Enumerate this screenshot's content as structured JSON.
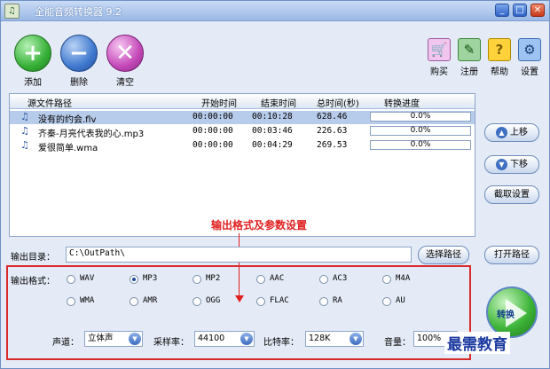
{
  "window": {
    "title": "全能音频转换器 9.2"
  },
  "toolbar": {
    "add": "添加",
    "delete": "删除",
    "clear": "清空"
  },
  "rightbar": {
    "buy": "购买",
    "register": "注册",
    "help": "帮助",
    "settings": "设置"
  },
  "filelist": {
    "headers": {
      "path": "源文件路径",
      "start": "开始时间",
      "end": "结束时间",
      "total": "总时间(秒)",
      "progress": "转换进度"
    },
    "rows": [
      {
        "name": "没有的约会.flv",
        "start": "00:00:00",
        "end": "00:10:28",
        "total": "628.46",
        "progress": "0.0%"
      },
      {
        "name": "齐秦-月亮代表我的心.mp3",
        "start": "00:00:00",
        "end": "00:03:46",
        "total": "226.63",
        "progress": "0.0%"
      },
      {
        "name": "爱很简单.wma",
        "start": "00:00:00",
        "end": "00:04:29",
        "total": "269.53",
        "progress": "0.0%"
      }
    ]
  },
  "sidebar": {
    "up": "上移",
    "down": "下移",
    "cut": "截取设置"
  },
  "annotation": "输出格式及参数设置",
  "output": {
    "label": "输出目录：",
    "path": "C:\\OutPath\\",
    "browse": "选择路径",
    "open": "打开路径"
  },
  "format": {
    "label": "输出格式：",
    "options": [
      "WAV",
      "MP3",
      "MP2",
      "AAC",
      "AC3",
      "M4A",
      "WMA",
      "AMR",
      "OGG",
      "FLAC",
      "RA",
      "AU"
    ],
    "selected": "MP3"
  },
  "params": {
    "channel_label": "声道：",
    "channel_value": "立体声",
    "samplerate_label": "采样率：",
    "samplerate_value": "44100",
    "bitrate_label": "比特率：",
    "bitrate_value": "128K",
    "volume_label": "音量：",
    "volume_value": "100%"
  },
  "convert": "转换",
  "watermark": "最需教育"
}
